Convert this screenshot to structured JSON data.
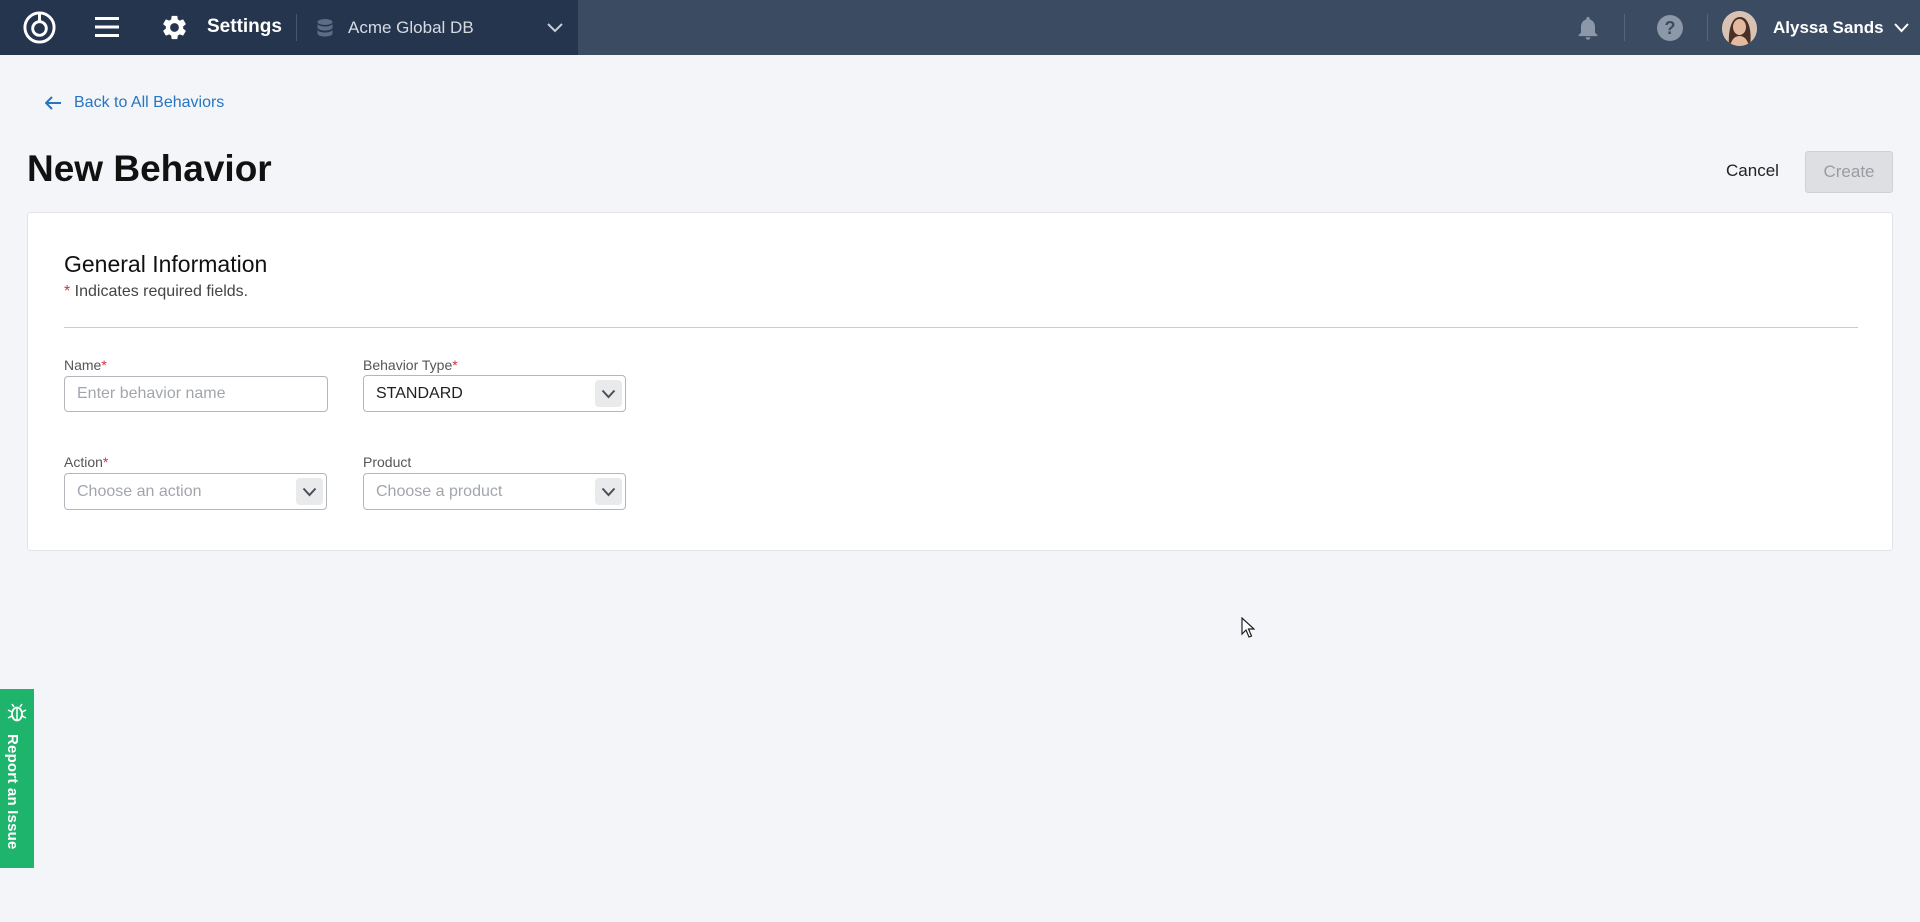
{
  "topbar": {
    "section_title": "Settings",
    "database_name": "Acme Global DB",
    "user_name": "Alyssa Sands"
  },
  "page": {
    "back_link": "Back to All Behaviors",
    "title": "New Behavior",
    "cancel_label": "Cancel",
    "create_label": "Create"
  },
  "form": {
    "section_title": "General Information",
    "required_star": "*",
    "required_note": " Indicates required fields.",
    "name": {
      "label": "Name",
      "required": "*",
      "value": "",
      "placeholder": "Enter behavior name"
    },
    "behavior_type": {
      "label": "Behavior Type",
      "required": "*",
      "value": "STANDARD"
    },
    "action": {
      "label": "Action",
      "required": "*",
      "placeholder": "Choose an action"
    },
    "product": {
      "label": "Product",
      "placeholder": "Choose a product"
    }
  },
  "report_tab": {
    "label": "Report an Issue"
  },
  "colors": {
    "topbar": "#3b4b62",
    "topbar_left": "#25354d",
    "link": "#2775c4",
    "required": "#d0343c",
    "report_tab": "#1eb46b"
  },
  "icons": [
    "app-logo-icon",
    "hamburger-menu-icon",
    "gear-icon",
    "database-icon",
    "chevron-down-icon",
    "bell-icon",
    "help-icon",
    "arrow-left-icon",
    "bug-icon"
  ]
}
